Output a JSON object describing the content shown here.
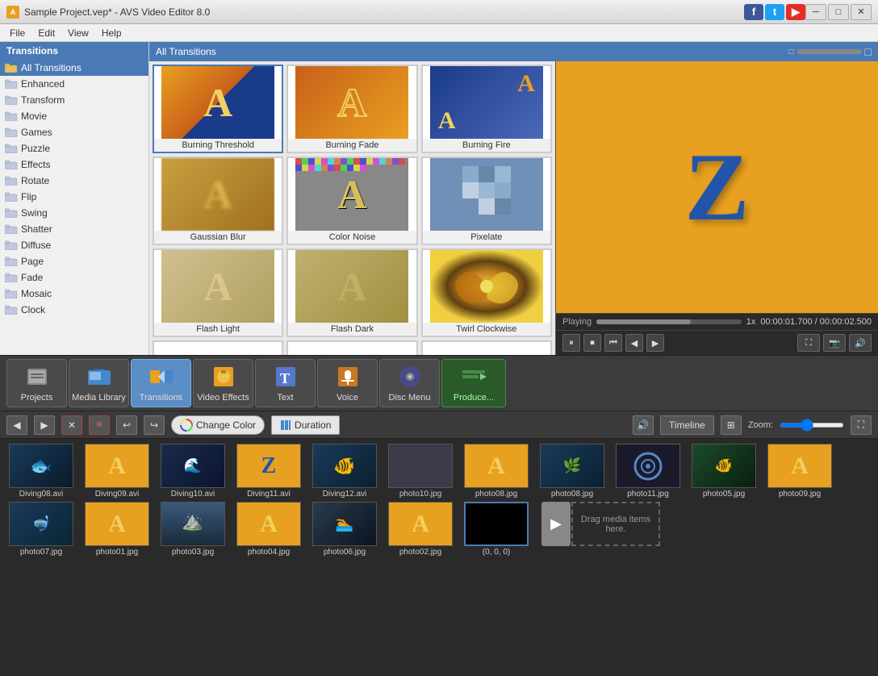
{
  "app": {
    "title": "Sample Project.vep* - AVS Video Editor 8.0",
    "icon_text": "A"
  },
  "titlebar": {
    "minimize": "─",
    "maximize": "□",
    "close": "✕"
  },
  "social": {
    "facebook": "f",
    "twitter": "t",
    "youtube": "▶"
  },
  "menu": {
    "file": "File",
    "edit": "Edit",
    "view": "View",
    "help": "Help"
  },
  "transitions_panel": {
    "header": "Transitions",
    "items": [
      {
        "label": "All Transitions",
        "active": true
      },
      {
        "label": "Enhanced"
      },
      {
        "label": "Transform"
      },
      {
        "label": "Movie"
      },
      {
        "label": "Games"
      },
      {
        "label": "Puzzle"
      },
      {
        "label": "Effects"
      },
      {
        "label": "Rotate"
      },
      {
        "label": "Flip"
      },
      {
        "label": "Swing"
      },
      {
        "label": "Shatter"
      },
      {
        "label": "Diffuse"
      },
      {
        "label": "Page"
      },
      {
        "label": "Fade"
      },
      {
        "label": "Mosaic"
      },
      {
        "label": "Clock"
      }
    ]
  },
  "transitions_grid": {
    "header": "All Transitions",
    "items": [
      {
        "label": "Burning Threshold",
        "style": "burning-threshold"
      },
      {
        "label": "Burning Fade",
        "style": "burning-fade"
      },
      {
        "label": "Burning Fire",
        "style": "burning-fire"
      },
      {
        "label": "Gaussian Blur",
        "style": "gaussian-blur"
      },
      {
        "label": "Color Noise",
        "style": "color-noise"
      },
      {
        "label": "Pixelate",
        "style": "pixelate"
      },
      {
        "label": "Flash Light",
        "style": "flash-light"
      },
      {
        "label": "Flash Dark",
        "style": "flash-dark"
      },
      {
        "label": "Twirl Clockwise",
        "style": "twirl"
      }
    ]
  },
  "preview": {
    "status": "Playing",
    "speed": "1x",
    "current_time": "00:00:01.700",
    "total_time": "00:00:02.500"
  },
  "toolbar": {
    "buttons": [
      {
        "label": "Projects",
        "icon": "projects"
      },
      {
        "label": "Media Library",
        "icon": "media"
      },
      {
        "label": "Transitions",
        "icon": "transitions",
        "active": true
      },
      {
        "label": "Video Effects",
        "icon": "effects"
      },
      {
        "label": "Text",
        "icon": "text"
      },
      {
        "label": "Voice",
        "icon": "voice"
      },
      {
        "label": "Disc Menu",
        "icon": "disc"
      },
      {
        "label": "Produce...",
        "icon": "produce"
      }
    ]
  },
  "timeline": {
    "change_color": "Change Color",
    "duration": "Duration",
    "view_mode": "Timeline",
    "zoom_label": "Zoom:"
  },
  "media_library": {
    "items": [
      {
        "name": "Diving08.avi",
        "type": "video"
      },
      {
        "name": "Diving09.avi",
        "type": "transition"
      },
      {
        "name": "Diving10.avi",
        "type": "video"
      },
      {
        "name": "Diving11.avi",
        "type": "transition"
      },
      {
        "name": "Diving12.avi",
        "type": "video"
      },
      {
        "name": "photo10.jpg",
        "type": "photo"
      },
      {
        "name": "photo08.jpg",
        "type": "photo"
      },
      {
        "name": "photo11.jpg",
        "type": "transition2"
      },
      {
        "name": "photo05.jpg",
        "type": "photo2"
      },
      {
        "name": "photo09.jpg",
        "type": "photo3"
      },
      {
        "name": "photo07.jpg",
        "type": "photo4"
      },
      {
        "name": "photo01.jpg",
        "type": "photo5"
      },
      {
        "name": "photo03.jpg",
        "type": "photo6"
      },
      {
        "name": "photo04.jpg",
        "type": "transition3"
      },
      {
        "name": "photo06.jpg",
        "type": "photo7"
      },
      {
        "name": "photo02.jpg",
        "type": "photo8"
      },
      {
        "name": "(0, 0, 0)",
        "type": "black"
      }
    ],
    "drag_here": "Drag media items here."
  }
}
